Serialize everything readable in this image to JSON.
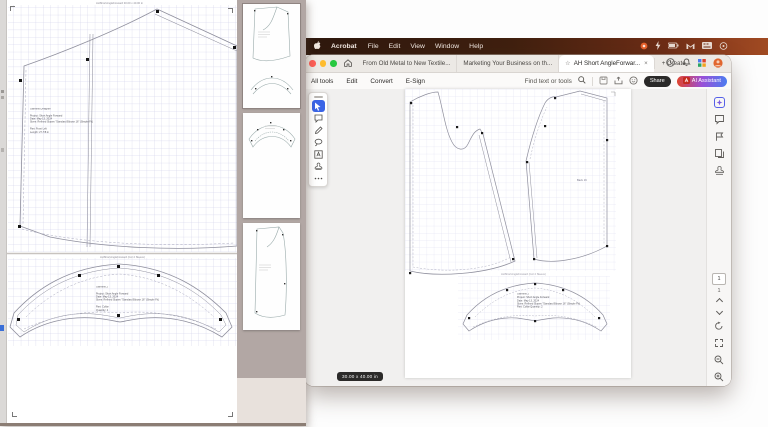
{
  "menu_bar": {
    "app": "Acrobat",
    "items": [
      "File",
      "Edit",
      "View",
      "Window",
      "Help"
    ],
    "status_icons": [
      "screen-record-icon",
      "bolt-icon",
      "battery-icon",
      "gmail-icon",
      "keyboard-icon",
      "control-center-icon"
    ]
  },
  "tab_bar": {
    "tabs": [
      {
        "label": "From Old Metal to New Textile..."
      },
      {
        "label": "Marketing Your Business on th..."
      },
      {
        "label": "AH Short AngleForwar...",
        "active": true,
        "starred": true
      }
    ],
    "create_label": "+ Create",
    "close_glyph": "×",
    "star_glyph": "☆",
    "right_icons": [
      "history-clock-icon",
      "notifications-bell-icon",
      "apps-grid-icon",
      "account-avatar"
    ]
  },
  "toolbar": {
    "all_tools": "All tools",
    "edit": "Edit",
    "convert": "Convert",
    "esign": "E-Sign",
    "find_label": "Find text or tools",
    "share_label": "Share",
    "ai_label": "AI Assistant",
    "right_icons": [
      "save-icon",
      "print-icon",
      "sticker-icon"
    ]
  },
  "quick_tools": [
    "drag-handle",
    "select-tool",
    "comment-tool",
    "pen-tool",
    "lasso-tool",
    "text-box-tool",
    "stamp-tool",
    "more-tools"
  ],
  "right_rail": {
    "top_icons": [
      "ai-assistant-icon",
      "comments-icon",
      "flag-icon",
      "pages-icon",
      "stamp-icon"
    ],
    "page_current": "1",
    "page_total": "1",
    "nav_icons": [
      "page-up-icon",
      "page-down-icon",
      "rotate-icon",
      "fit-view-icon",
      "zoom-out-icon",
      "zoom-in-icon"
    ]
  },
  "size_tooltip": "30.00 x 40.00 in",
  "acrobat_doc": {
    "back_label": "Back  16",
    "collar_header": "AHShortAngleForward (Col 2 Sleeve)",
    "collar_info": "Garment 2\nProject: Short Angle Forward\nDate:  May 13, 2024\nSizes: Refined Slopes \"Standard Blouse 16\" (Simple Fit)\nPart:  Collar   Quantity: 2"
  },
  "left_window": {
    "page1_header": "AHShortAngleForward 30.00 x 40.00 in",
    "page1_info": "Garment Designer\n\nProject: Short Angle Forward\nDate:   May 13, 2024\nSizes:  Refined Slopes \"Standard Blouse 16\" (Simple Fit)\n\nPart:   Front Left\nLength: 27-7/8 in",
    "page2_header": "AHShortAngleForward (Col 2 Sleeve)",
    "page2_info": "Garment 2\n\nProject: Short Angle Forward\nDate:   May 13, 2024\nSizes:  Refined Slopes \"Standard Blouse 16\" (Simple Fit)\n\nPart:   Collar\nQuantity: 2"
  },
  "colors": {
    "menu_bar_left": "#2e180e",
    "menu_bar_right": "#a04a22",
    "accent_blue": "#3a64e6",
    "share_black": "#2b2a29",
    "ai_gradient": [
      "#e0442e",
      "#9a50d8",
      "#4b7cf0"
    ],
    "avatar_orange": "#e1662f",
    "traffic": [
      "#ff5f57",
      "#febc2e",
      "#28c840"
    ],
    "grid_line": "#d2d2ea",
    "panel_mauve": "#b2a7a4"
  }
}
